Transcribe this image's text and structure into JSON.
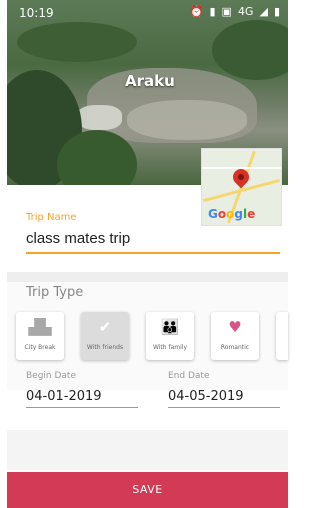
{
  "status_bar": {
    "time": "10:19",
    "icons": [
      "alarm-icon",
      "vibrate-icon",
      "volte-icon",
      "4g-icon",
      "signal-icon",
      "battery-icon"
    ],
    "network_label": "4G"
  },
  "hero": {
    "place_name": "Araku"
  },
  "map_thumbnail": {
    "logo_text": "Google"
  },
  "trip_name": {
    "label": "Trip Name",
    "value": "class mates trip"
  },
  "trip_type": {
    "label": "Trip Type",
    "options": [
      {
        "label": "City Break",
        "icon": "city-icon",
        "selected": false
      },
      {
        "label": "With friends",
        "icon": "friends-icon",
        "selected": true
      },
      {
        "label": "With family",
        "icon": "family-icon",
        "selected": false
      },
      {
        "label": "Romantic",
        "icon": "heart-icon",
        "selected": false
      }
    ]
  },
  "dates": {
    "begin_label": "Begin Date",
    "begin_value": "04-01-2019",
    "end_label": "End Date",
    "end_value": "04-05-2019"
  },
  "save_label": "SAVE",
  "colors": {
    "accent": "#f5a623",
    "save_button": "#d23a55",
    "map_pin": "#d93025"
  }
}
